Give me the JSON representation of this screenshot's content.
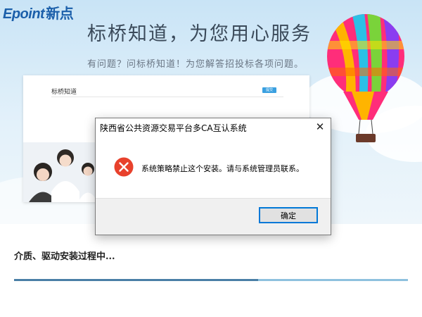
{
  "brand": {
    "name_latin": "Epoint",
    "name_cn": "新点"
  },
  "banner": {
    "headline": "标桥知道，为您用心服务",
    "subline": "有问题？问标桥知道！为您解答招投标各项问题。"
  },
  "preview": {
    "title": "标桥知道",
    "button_label": "提交"
  },
  "dialog": {
    "title": "陕西省公共资源交易平台多CA互认系统",
    "message": "系统策略禁止这个安装。请与系统管理员联系。",
    "ok_label": "确定",
    "close_icon": "close-icon",
    "status_icon": "error-icon"
  },
  "install": {
    "status_text": "介质、驱动安装过程中...",
    "progress": 0.62
  },
  "colors": {
    "accent": "#1b5faa",
    "error_red": "#e8412c",
    "progress_track": "#8ec1de",
    "progress_fill": "#4a7fa6",
    "button_border": "#0078d7"
  }
}
